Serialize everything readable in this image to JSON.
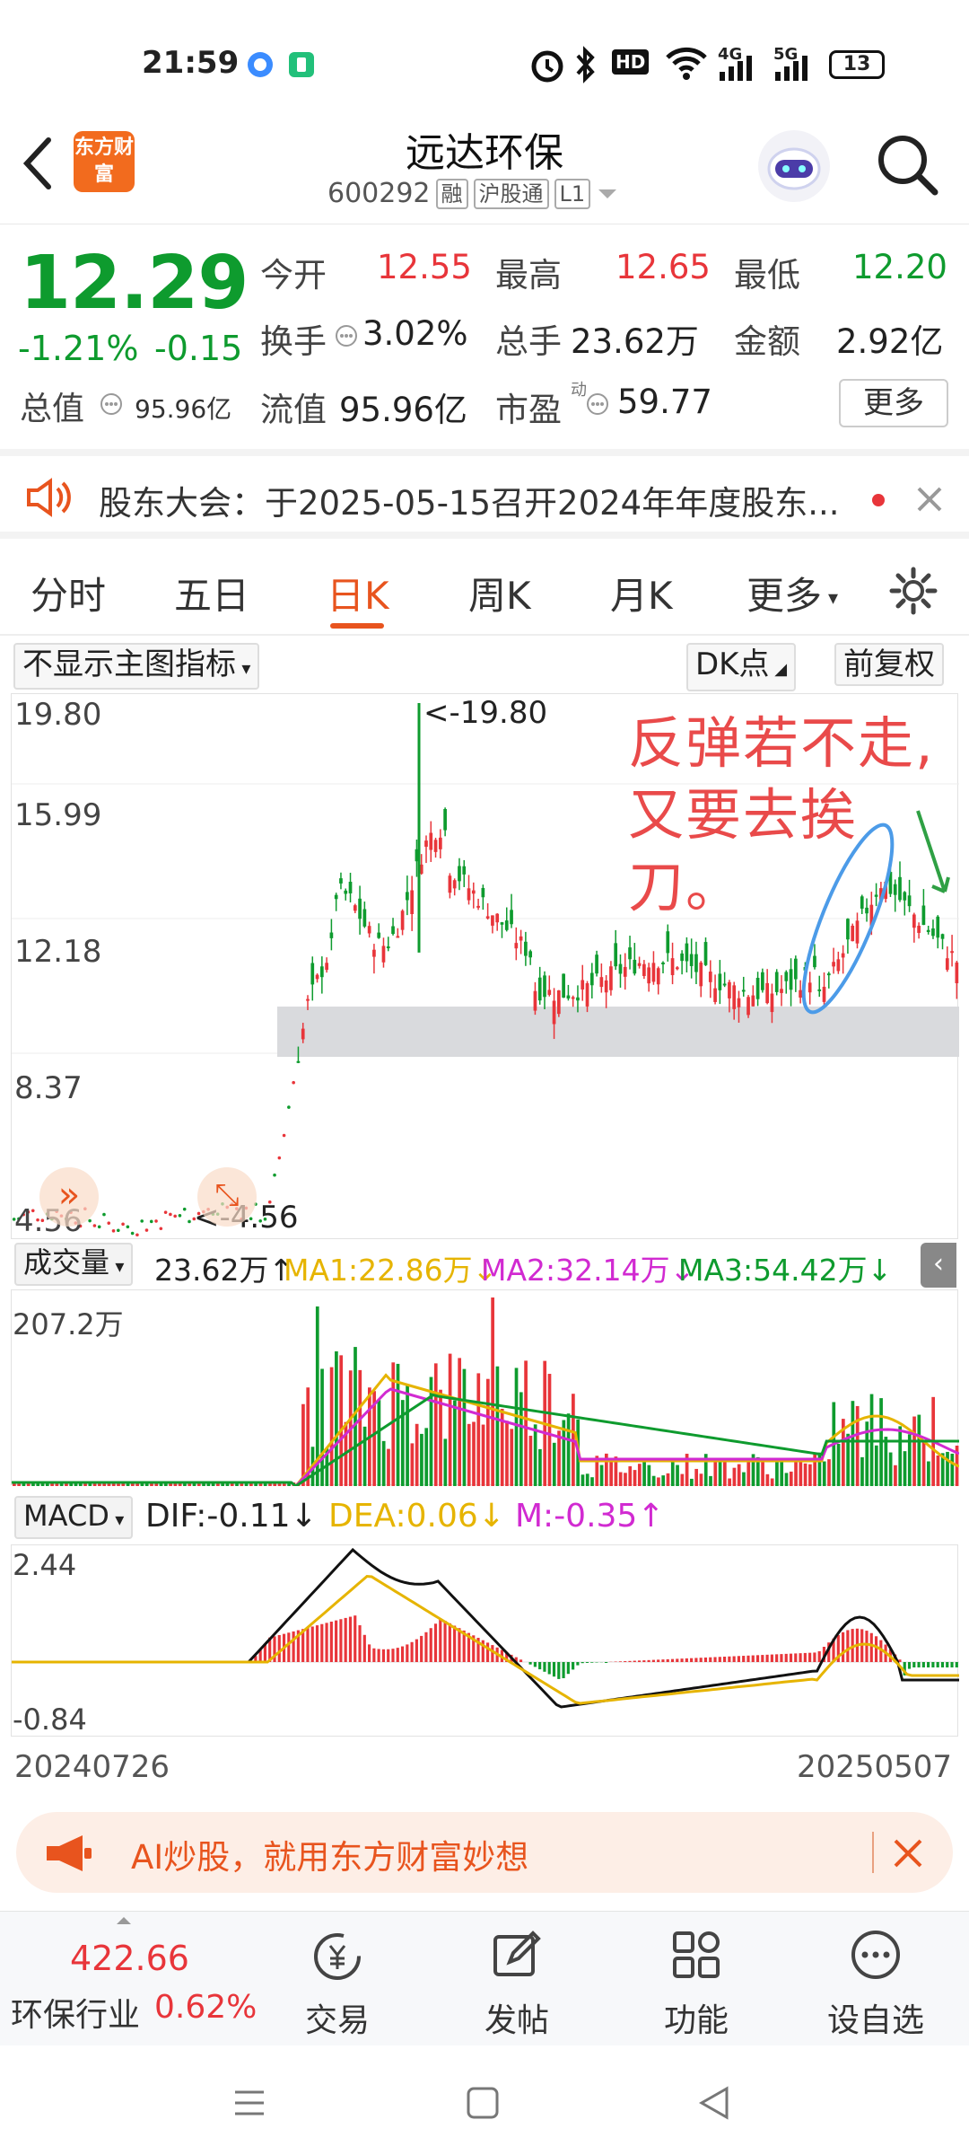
{
  "status_bar": {
    "time": "21:59",
    "hd_badge": "HD",
    "net1": "4G",
    "net2": "5G",
    "battery": "13"
  },
  "header": {
    "logo_text": "东方财富",
    "title": "远达环保",
    "code": "600292",
    "tags": [
      "融",
      "沪股通",
      "L1"
    ]
  },
  "quote": {
    "price": "12.29",
    "change_pct": "-1.21%",
    "change_abs": "-0.15",
    "open_label": "今开",
    "open": "12.55",
    "high_label": "最高",
    "high": "12.65",
    "low_label": "最低",
    "low": "12.20",
    "turnover_label": "换手",
    "turnover": "3.02%",
    "volume_label": "总手",
    "volume": "23.62万",
    "amount_label": "金额",
    "amount": "2.92亿",
    "mktcap_label": "总值",
    "mktcap": "95.96亿",
    "float_label": "流值",
    "float": "95.96亿",
    "pe_label": "市盈",
    "pe_sup": "动",
    "pe": "59.77",
    "more": "更多"
  },
  "notice": {
    "text": "股东大会：于2025-05-15召开2024年年度股东..."
  },
  "tabs": [
    "分时",
    "五日",
    "日K",
    "周K",
    "月K",
    "更多"
  ],
  "active_tab": "日K",
  "chart_controls": {
    "indicator_select": "不显示主图指标",
    "dk_points": "DK点",
    "adjust": "前复权"
  },
  "main_chart": {
    "y_labels": [
      "19.80",
      "15.99",
      "12.18",
      "8.37",
      "4.56"
    ],
    "max_marker": "<-19.80",
    "min_marker": "<-4.56",
    "annotation_line1": "反弹若不走,",
    "annotation_line2": "又要去挨刀。"
  },
  "volume_panel": {
    "select": "成交量",
    "value": "23.62万↑",
    "ma1": "MA1:22.86万↓",
    "ma2": "MA2:32.14万↓",
    "ma3": "MA3:54.42万↓",
    "ytop": "207.2万"
  },
  "macd_panel": {
    "select": "MACD",
    "dif": "DIF:-0.11↓",
    "dea": "DEA:0.06↓",
    "m": "M:-0.35↑",
    "ytop": "2.44",
    "ybottom": "-0.84"
  },
  "date_range": {
    "start": "20240726",
    "end": "20250507"
  },
  "ai_banner": {
    "text": "AI炒股，就用东方财富妙想"
  },
  "bottom_nav": {
    "index_value": "422.66",
    "index_name": "环保行业",
    "index_change": "0.62%",
    "items": [
      "交易",
      "发帖",
      "功能",
      "设自选"
    ]
  },
  "colors": {
    "up": "#e8353a",
    "down": "#0e9b2e",
    "accent": "#e8541e"
  }
}
